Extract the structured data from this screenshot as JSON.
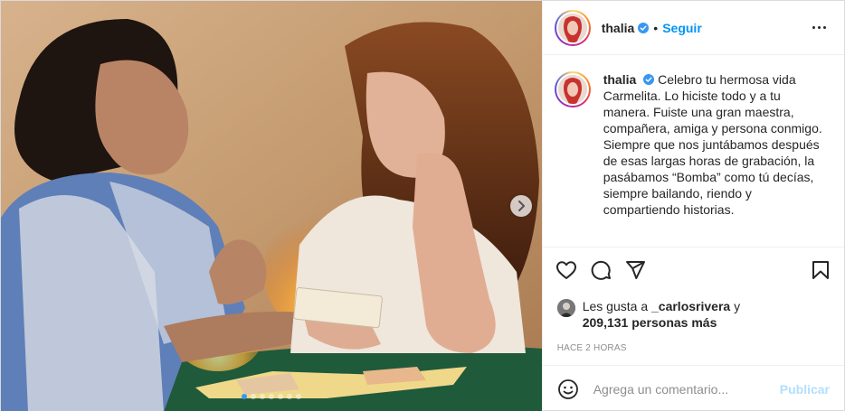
{
  "post": {
    "username": "thalia",
    "separator": "•",
    "follow_label": "Seguir",
    "caption": "Celebro tu hermosa vida Carmelita. Lo hiciste todo y a tu manera. Fuiste una gran maestra, compañera, amiga y persona conmigo. Siempre que nos juntábamos después de esas largas horas de grabación, la pasábamos “Bomba” como tú decías, siempre bailando, riendo y compartiendo historias.",
    "likes_prefix": "Les gusta a ",
    "likes_user": "_carlosrivera",
    "likes_and": " y",
    "likes_count": "209,131 personas más",
    "time_ago": "HACE 2 HORAS",
    "comment_placeholder": "Agrega un comentario...",
    "publish_label": "Publicar"
  },
  "carousel": {
    "total": 7,
    "active_index": 0
  },
  "icons": {
    "more": "more-options-icon",
    "like": "heart-icon",
    "comment": "comment-icon",
    "share": "share-icon",
    "save": "bookmark-icon",
    "emoji": "emoji-icon",
    "next": "chevron-right-icon",
    "verified": "verified-badge-icon"
  },
  "colors": {
    "accent": "#0095f6",
    "verified": "#3897f0",
    "publish_disabled": "#b2dffc",
    "muted": "#8e8e8e"
  }
}
